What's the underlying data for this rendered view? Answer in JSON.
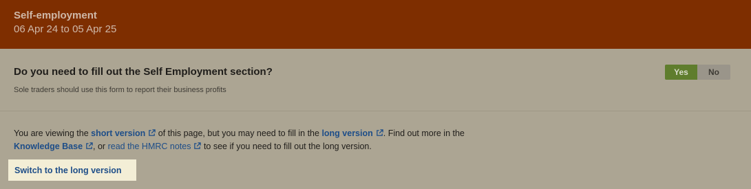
{
  "header": {
    "title": "Self-employment",
    "dates": "06 Apr 24 to 05 Apr 25"
  },
  "question": {
    "text": "Do you need to fill out the Self Employment section?",
    "hint": "Sole traders should use this form to report their business profits",
    "yes_label": "Yes",
    "no_label": "No",
    "selected": "Yes"
  },
  "info": {
    "p1": "You are viewing the ",
    "short_version": "short version",
    "p2": " of this page, but you may need to fill in the ",
    "long_version": "long version",
    "p3": ". Find out more in the ",
    "knowledge_base": "Knowledge Base",
    "p4": ", or ",
    "hmrc_notes": "read the HMRC notes",
    "p5": " to see if you need to fill out the long version."
  },
  "switch_label": "Switch to the long version",
  "colors": {
    "header_bg": "#7e2e00",
    "page_bg": "#aca593",
    "yes_active": "#5f7d2d",
    "link": "#1d4d88",
    "highlight": "#f3eed6"
  },
  "icons": [
    "external-link-icon"
  ]
}
